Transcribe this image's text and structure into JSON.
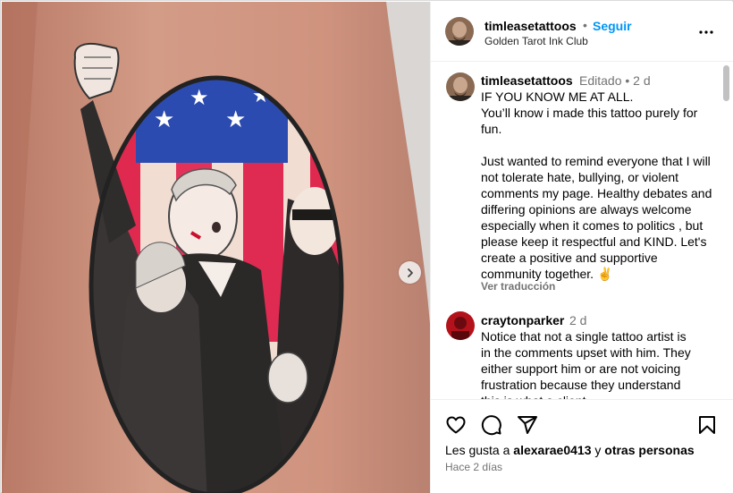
{
  "post": {
    "username": "timleasetattoos",
    "follow_label": "Seguir",
    "separator": "•",
    "location": "Golden Tarot Ink Club",
    "more_icon": "more-horizontal-icon"
  },
  "media": {
    "next_icon": "chevron-right-icon"
  },
  "caption": {
    "username": "timleasetattoos",
    "meta": "Editado • 2 d",
    "text": "IF YOU KNOW ME AT ALL.\nYou’ll know i made this tattoo purely for fun.\n\nJust wanted to remind everyone that I will not tolerate hate, bullying, or violent comments my page. Healthy debates and differing opinions are always welcome especially when it comes to politics , but please keep it respectful and KIND. Let's create a positive and supportive community together. ✌️",
    "translate_label": "Ver traducción"
  },
  "comments": [
    {
      "username": "craytonparker",
      "meta": "2 d",
      "text": "Notice that not a single tattoo artist is in the comments upset with him. They either support him or are not voicing frustration because they understand this is what a client"
    }
  ],
  "actions": {
    "icons": [
      "heart-icon",
      "comment-icon",
      "share-icon",
      "bookmark-icon"
    ],
    "likes_prefix": "Les gusta a",
    "likes_user": "alexarae0413",
    "likes_conj": "y",
    "likes_rest": "otras personas",
    "timestamp": "Hace 2 días"
  },
  "colors": {
    "accent": "#0095f6",
    "muted": "#737373",
    "border": "#efefef"
  }
}
